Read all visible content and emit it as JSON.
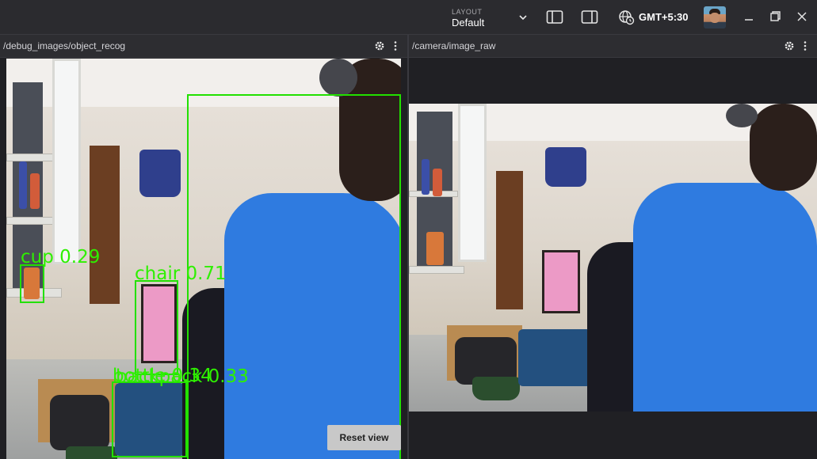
{
  "topbar": {
    "layout_caption": "LAYOUT",
    "layout_value": "Default",
    "timezone": "GMT+5:30"
  },
  "panels": [
    {
      "title": "/debug_images/object_recog"
    },
    {
      "title": "/camera/image_raw"
    }
  ],
  "detections": [
    {
      "label": "cup 0.29"
    },
    {
      "label": "chair 0.71"
    },
    {
      "label": "bottle 0.34"
    },
    {
      "label": "backpack 0.33"
    }
  ],
  "reset_view_label": "Reset view",
  "colors": {
    "detection": "#22e000",
    "topbar": "#2b2b2f",
    "panel_header": "#2d2d31"
  }
}
